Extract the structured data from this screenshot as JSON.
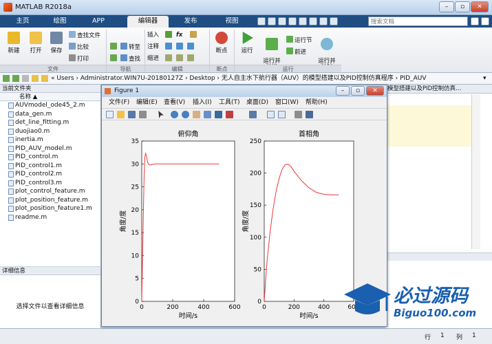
{
  "window": {
    "title": "MATLAB R2018a",
    "btn_min": "–",
    "btn_max": "▫",
    "btn_close": "✕"
  },
  "tabs": [
    {
      "label": "主页"
    },
    {
      "label": "绘图"
    },
    {
      "label": "APP"
    },
    {
      "label": "编辑器"
    },
    {
      "label": "发布"
    },
    {
      "label": "视图"
    }
  ],
  "search": {
    "placeholder": "搜索文档"
  },
  "ribbon": {
    "new": "新建",
    "open": "打开",
    "save": "保存",
    "find_files": "查找文件",
    "compare": "比较",
    "print": "打印",
    "insert": "插入",
    "comment": "注释",
    "indent": "缩进",
    "fx": "fx",
    "goto": "转至",
    "find": "查找",
    "breakpoints": "断点",
    "run": "运行",
    "run_advance": "运行并\n前进",
    "run_section": "运行节",
    "advance": "前进",
    "run_time": "运行并\n计时",
    "groups": {
      "file": "文件",
      "navigate": "导航",
      "edit": "编辑",
      "breakpoints": "断点",
      "run": "运行"
    }
  },
  "address": {
    "path": "« Users › Administrator.WIN7U-20180127Z › Desktop › 无人自主水下航行器（AUV）的模型搭建以及PID控制仿真程序 › PID_AUV"
  },
  "current_folder": {
    "title": "当前文件夹",
    "column": "名称 ▲",
    "files": [
      "AUVmodel_ode45_2.m",
      "data_gen.m",
      "det_line_fitting.m",
      "duojiao0.m",
      "inertia.m",
      "PID_AUV_model.m",
      "PID_control.m",
      "PID_control1.m",
      "PID_control2.m",
      "PID_control3.m",
      "plot_control_feature.m",
      "plot_position_feature.m",
      "plot_position_feature1.m",
      "readme.m"
    ]
  },
  "details": {
    "title": "详细信息",
    "message": "选择文件以查看详细信息"
  },
  "editor_tab": {
    "label": "模型搭建以及PID控制仿真..."
  },
  "status": {
    "row_label": "行",
    "row": "1",
    "col_label": "列",
    "col": "1"
  },
  "figure": {
    "title": "Figure 1",
    "menu": [
      "文件(F)",
      "编辑(E)",
      "查看(V)",
      "插入(I)",
      "工具(T)",
      "桌面(D)",
      "窗口(W)",
      "帮助(H)"
    ]
  },
  "watermark": {
    "text_cn": "必过源码",
    "text_url": "Biguo100.com"
  },
  "colors": {
    "tab_bg": "#1e4e82",
    "line": "#e8383c",
    "brand": "#1a5fb0"
  },
  "chart_data": [
    {
      "type": "line",
      "title": "俯仰角",
      "xlabel": "时间/s",
      "ylabel": "角度/度",
      "xlim": [
        0,
        600
      ],
      "ylim": [
        0,
        35
      ],
      "xticks": [
        0,
        200,
        400,
        600
      ],
      "yticks": [
        0,
        5,
        10,
        15,
        20,
        25,
        30,
        35
      ],
      "series": [
        {
          "x": [
            0,
            5,
            10,
            15,
            20,
            25,
            30,
            35,
            40,
            45,
            50,
            60,
            70,
            80,
            100,
            150,
            200,
            300,
            400,
            500
          ],
          "y": [
            0,
            9,
            19,
            27,
            31.5,
            32.3,
            31.8,
            30.8,
            30.2,
            29.9,
            29.8,
            29.8,
            29.9,
            30.0,
            30.0,
            30.0,
            30.0,
            30.0,
            30.0,
            30.0
          ]
        }
      ]
    },
    {
      "type": "line",
      "title": "首相角",
      "xlabel": "时间/s",
      "ylabel": "角度/度",
      "xlim": [
        0,
        600
      ],
      "ylim": [
        0,
        250
      ],
      "xticks": [
        0,
        200,
        400,
        600
      ],
      "yticks": [
        0,
        50,
        100,
        150,
        200,
        250
      ],
      "series": [
        {
          "x": [
            0,
            10,
            20,
            40,
            60,
            80,
            100,
            120,
            140,
            160,
            180,
            200,
            250,
            300,
            350,
            400,
            450,
            500
          ],
          "y": [
            0,
            35,
            65,
            110,
            145,
            172,
            192,
            206,
            213,
            214,
            210,
            203,
            188,
            177,
            170,
            167,
            166,
            166
          ]
        }
      ]
    }
  ]
}
